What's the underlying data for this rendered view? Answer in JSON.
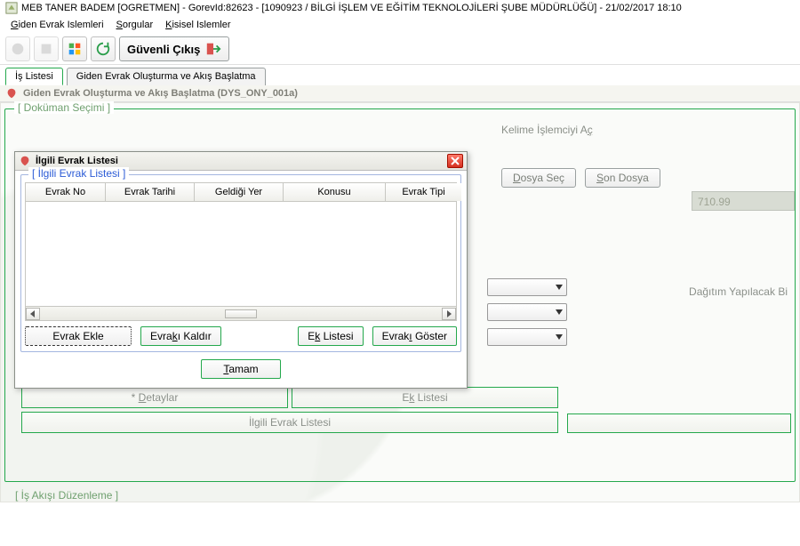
{
  "titlebar": {
    "text": "MEB  TANER BADEM  [OGRETMEN] - GorevId:82623 - [1090923 / BİLGİ İŞLEM VE EĞİTİM TEKNOLOJİLERİ ŞUBE MÜDÜRLÜĞÜ] - 21/02/2017 18:10"
  },
  "menubar": {
    "items": [
      {
        "pre": "G",
        "rest": "iden Evrak Islemleri"
      },
      {
        "pre": "S",
        "rest": "orgular"
      },
      {
        "pre": "K",
        "rest": "isisel Islemler"
      }
    ]
  },
  "toolbar": {
    "safe_exit_label": "Güvenli Çıkış"
  },
  "tabs": {
    "items": [
      {
        "label": "İş Listesi",
        "active": true
      },
      {
        "label": "Giden Evrak Oluşturma ve Akış Başlatma",
        "active": false
      }
    ]
  },
  "section": {
    "title": "Giden Evrak Oluşturma ve Akış Başlatma (DYS_ONY_001a)"
  },
  "groups": {
    "dokuman": "[ Doküman Seçimi ]",
    "akis": "[ İş Akışı Düzenleme ]"
  },
  "right": {
    "link_pre": "Kelime İşlemciyi A",
    "link_u": "ç",
    "dosya_pre": "D",
    "dosya_rest": "osya Seç",
    "son_pre": "S",
    "son_rest": "on Dosya",
    "readonly_value": "710.99",
    "dist_label": "Dağıtım Yapılacak Bi"
  },
  "dialog": {
    "title": "İlgili Evrak Listesi",
    "group_title": "[ İlgili Evrak Listesi ]",
    "columns": [
      "Evrak No",
      "Evrak Tarihi",
      "Geldiği Yer",
      "Konusu",
      "Evrak Tipi"
    ],
    "buttons": {
      "ekle": "Evrak Ekle",
      "kaldir_pre": "Evra",
      "kaldir_u": "k",
      "kaldir_rest": "ı Kaldır",
      "eklist_pre": "E",
      "eklist_u": "k",
      "eklist_rest": " Listesi",
      "goster_pre": "Evrak",
      "goster_u": "ı",
      "goster_rest": " Göster",
      "tamam_u": "T",
      "tamam_rest": "amam"
    }
  },
  "bottom": {
    "detaylar": "* Detaylar",
    "eklist_pre": "E",
    "eklist_u": "k",
    "eklist_rest": " Listesi",
    "ilgili_pre": "İl",
    "ilgili_u": "g",
    "ilgili_rest": "ili Evrak Listesi"
  }
}
